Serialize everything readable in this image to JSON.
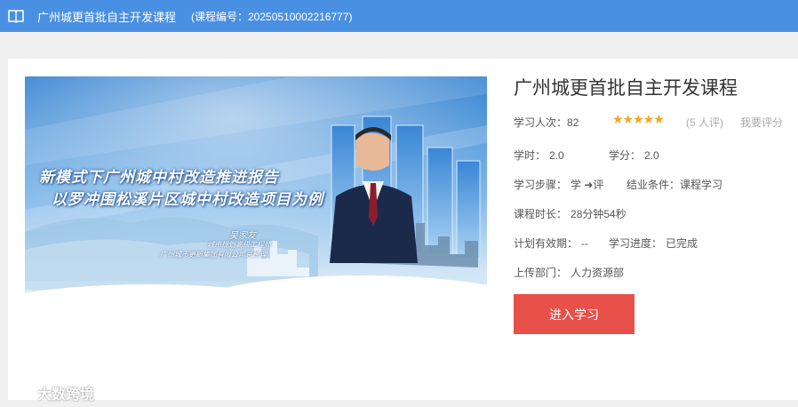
{
  "header": {
    "title": "广州城更首批自主开发课程",
    "code": "(课程编号：20250510002216777)"
  },
  "banner": {
    "headline_1": "新模式下广州城中村改造推进报告",
    "headline_2": "以罗冲围松溪片区城中村改造项目为例",
    "lecturer_name": "吴家友",
    "lecturer_title_1": "城市规划高级工程师",
    "lecturer_title_2": "广州城市更新集团有限公司总经理"
  },
  "course": {
    "title": "广州城更首批自主开发课程",
    "learners_label": "学习人次：",
    "learners_value": "82",
    "rating_stars": "★★★★★",
    "rating_count": "(5 人评)",
    "rate_link": "我要评分",
    "hours_label": "学时：",
    "hours_value": "2.0",
    "credits_label": "学分：",
    "credits_value": "2.0",
    "steps_label": "学习步骤：",
    "steps_value": "学 ➜评",
    "completion_label": "结业条件：",
    "completion_value": "课程学习",
    "duration_label": "课程时长：",
    "duration_value": "28分钟54秒",
    "validity_label": "计划有效期：",
    "validity_value": "--",
    "progress_label": "学习进度：",
    "progress_value": "已完成",
    "dept_label": "上传部门：",
    "dept_value": "人力资源部",
    "enter_button": "进入学习"
  },
  "watermark": {
    "text": "大数跨境"
  },
  "colors": {
    "header_bg": "#4a90e2",
    "button_bg": "#e8504a",
    "star": "#f5a623"
  }
}
